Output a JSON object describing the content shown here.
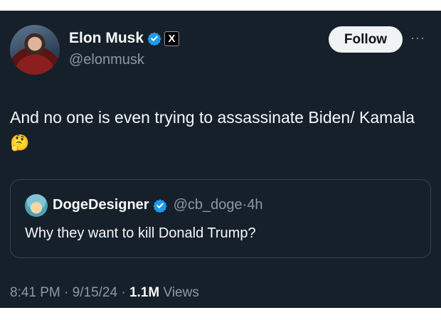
{
  "author": {
    "name": "Elon Musk",
    "handle": "@elonmusk",
    "affiliate_badge": "X"
  },
  "actions": {
    "follow_label": "Follow",
    "more_label": "···"
  },
  "tweet": {
    "text": "And no one is even trying to assassinate Biden/ Kamala",
    "emoji": "🤔"
  },
  "quote": {
    "name": "DogeDesigner",
    "handle": "@cb_doge",
    "separator": "·",
    "age": "4h",
    "text": "Why they want to kill Donald Trump?"
  },
  "footer": {
    "time": "8:41 PM",
    "sep1": "·",
    "date": "9/15/24",
    "sep2": "·",
    "views_count": "1.1M",
    "views_label": "Views"
  },
  "colors": {
    "background": "#15202b",
    "verified": "#1d9bf0",
    "secondary_text": "#8b98a5"
  }
}
